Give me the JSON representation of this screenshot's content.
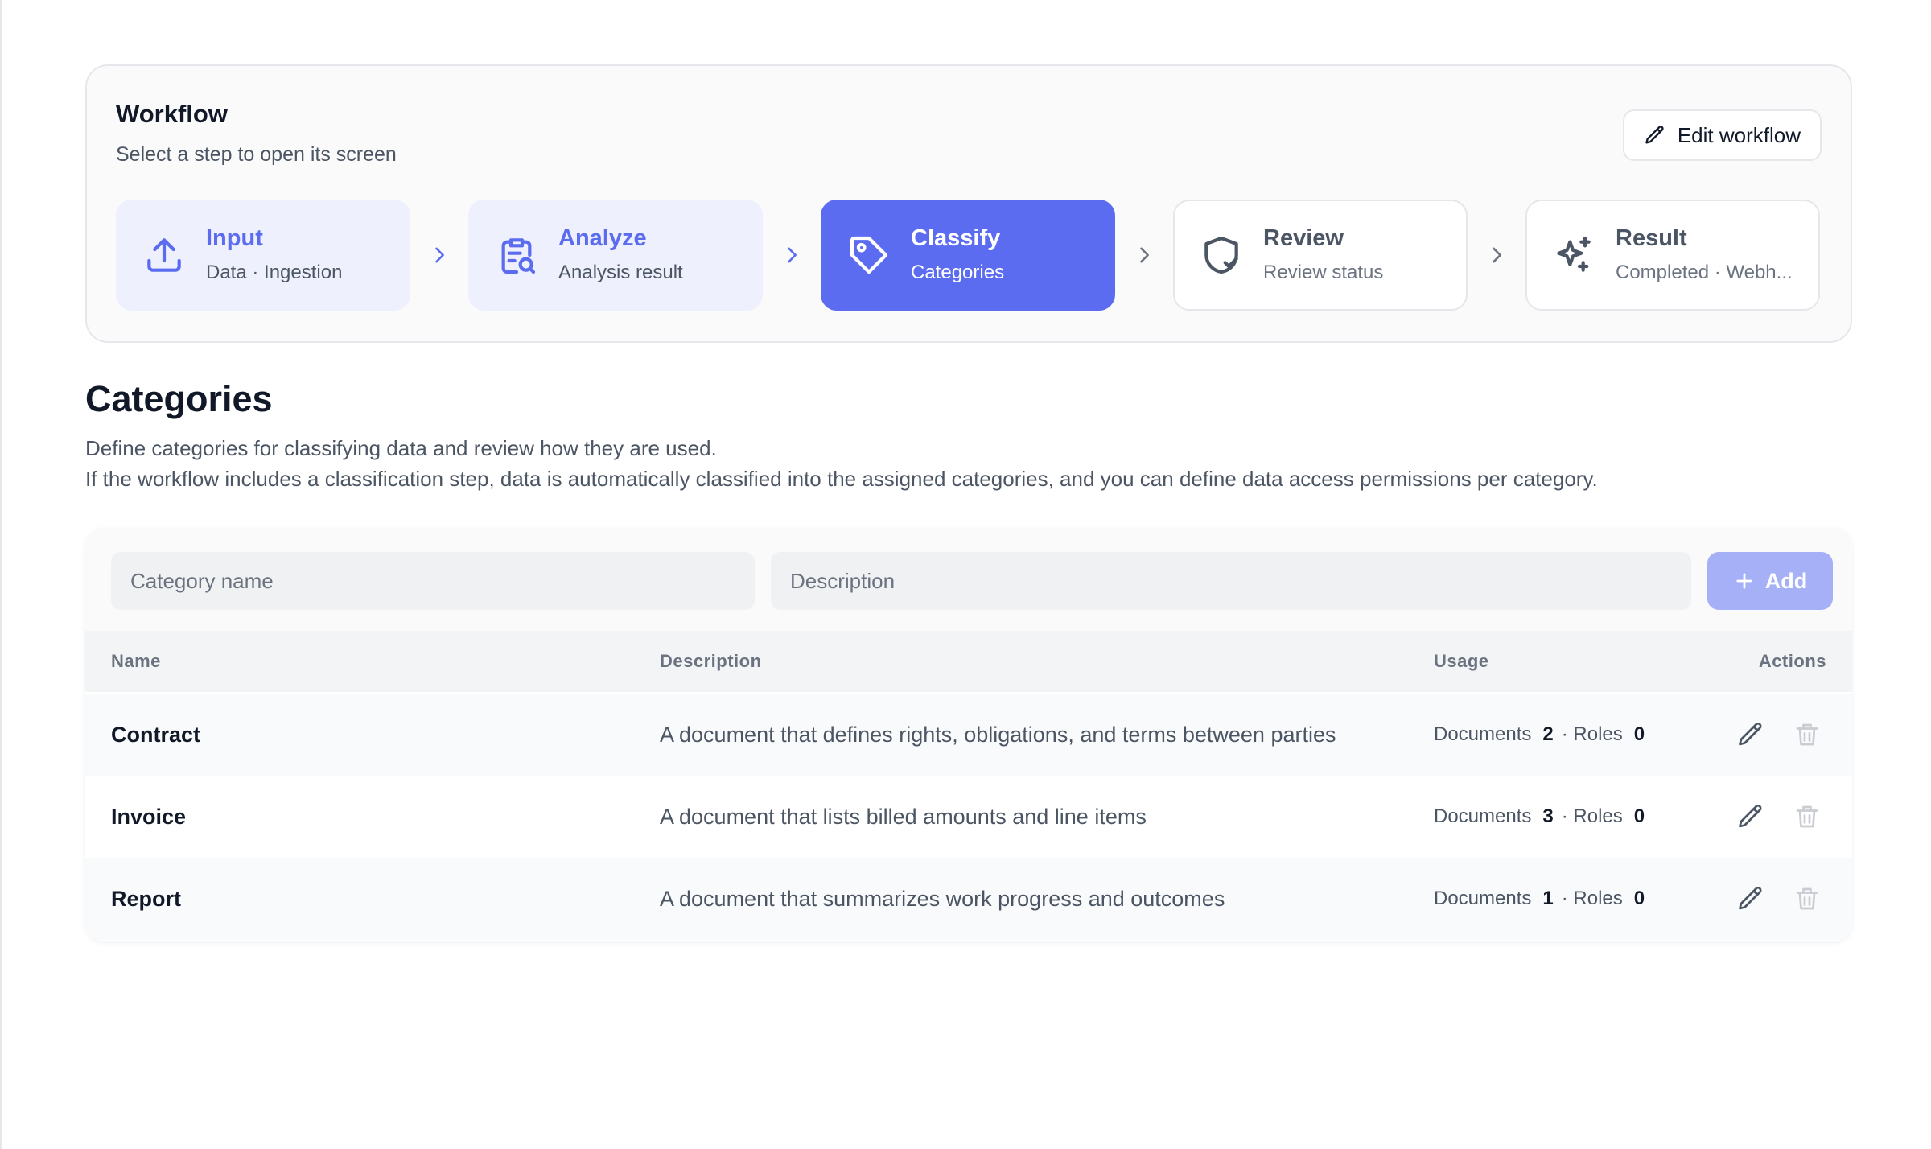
{
  "workflow": {
    "title": "Workflow",
    "subtitle": "Select a step to open its screen",
    "edit_label": "Edit workflow",
    "steps": [
      {
        "label": "Input",
        "caption": "Data · Ingestion",
        "icon": "upload-icon",
        "state": "done"
      },
      {
        "label": "Analyze",
        "caption": "Analysis result",
        "icon": "clipboard-search-icon",
        "state": "done"
      },
      {
        "label": "Classify",
        "caption": "Categories",
        "icon": "tag-icon",
        "state": "active"
      },
      {
        "label": "Review",
        "caption": "Review status",
        "icon": "shield-check-icon",
        "state": "todo"
      },
      {
        "label": "Result",
        "caption": "Completed · Webh...",
        "icon": "sparkles-icon",
        "state": "todo"
      }
    ]
  },
  "categories": {
    "title": "Categories",
    "description_line1": "Define categories for classifying data and review how they are used.",
    "description_line2": "If the workflow includes a classification step, data is automatically classified into the assigned categories, and you can define data access permissions per category.",
    "name_placeholder": "Category name",
    "description_placeholder": "Description",
    "add_label": "Add",
    "columns": {
      "name": "Name",
      "description": "Description",
      "usage": "Usage",
      "actions": "Actions"
    },
    "usage_documents_label": "Documents",
    "usage_roles_label": "· Roles",
    "rows": [
      {
        "name": "Contract",
        "description": "A document that defines rights, obligations, and terms between parties",
        "documents": "2",
        "roles": "0"
      },
      {
        "name": "Invoice",
        "description": "A document that lists billed amounts and line items",
        "documents": "3",
        "roles": "0"
      },
      {
        "name": "Report",
        "description": "A document that summarizes work progress and outcomes",
        "documents": "1",
        "roles": "0"
      }
    ]
  },
  "colors": {
    "accent": "#5b6cf0",
    "accent_light": "#eef0fd",
    "add_button": "#a5b0f7"
  }
}
